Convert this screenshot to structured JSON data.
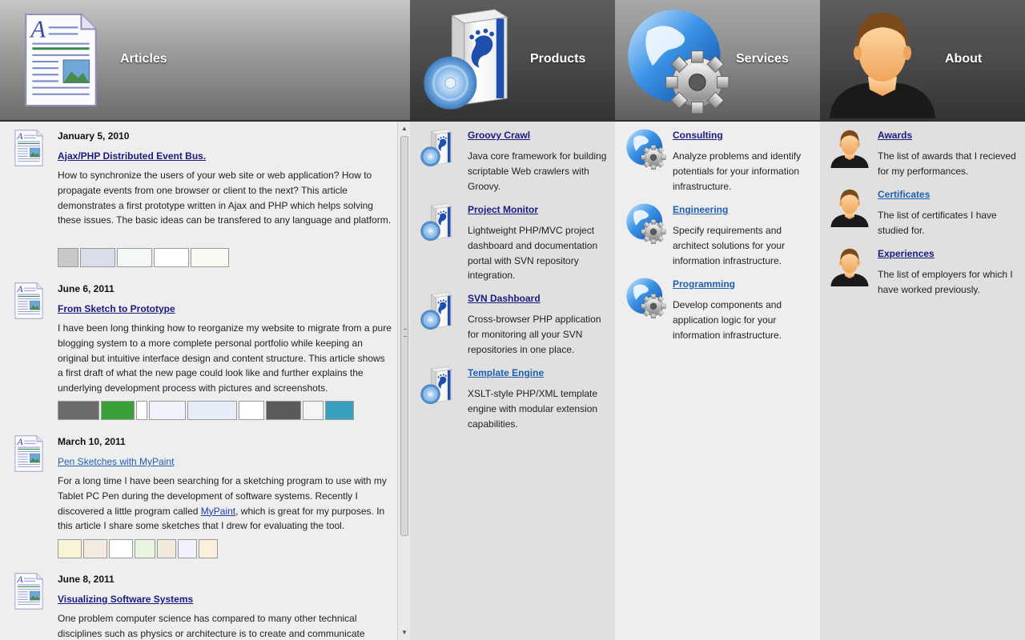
{
  "nav": {
    "articles": "Articles",
    "products": "Products",
    "services": "Services",
    "about": "About"
  },
  "articles": [
    {
      "date": "January 5, 2010",
      "title": "Ajax/PHP Distributed Event Bus.",
      "body": "How to synchronize the users of your web site or web application? How to propagate events from one browser or client to the next? This article demonstrates a first prototype written in Ajax and PHP which helps solving these issues. The basic ideas can be transfered to any language and platform."
    },
    {
      "date": "June 6, 2011",
      "title": "From Sketch to Prototype",
      "body": "I have been long thinking how to reorganize my website to migrate from a pure blogging system to a more complete personal portfolio while keeping an original but intuitive interface design and content structure. This article shows a first draft of what the new page could look like and further explains the underlying development process with pictures and screenshots."
    },
    {
      "date": "March 10, 2011",
      "title": "Pen Sketches with MyPaint",
      "body_before": "For a long time I have been searching for a sketching program to use with my Tablet PC Pen during the development of software systems. Recently I discovered a little program called ",
      "body_link": "MyPaint",
      "body_after": ", which is great for my purposes. In this article I share some sketches that I drew for evaluating the tool."
    },
    {
      "date": "June 8, 2011",
      "title": "Visualizing Software Systems",
      "body": "One problem computer science has compared to many other technical disciplines such as physics or architecture is to create and communicate"
    }
  ],
  "products": [
    {
      "title": "Groovy Crawl",
      "body": "Java core framework for building scriptable Web crawlers with Groovy."
    },
    {
      "title": "Project Monitor",
      "body": "Lightweight PHP/MVC project dashboard and documentation portal with SVN repository integration."
    },
    {
      "title": "SVN Dashboard",
      "body": "Cross-browser PHP application for monitoring all your SVN repositories in one place."
    },
    {
      "title": "Template Engine",
      "body": "XSLT-style PHP/XML template engine with modular extension capabilities."
    }
  ],
  "services": [
    {
      "title": "Consulting",
      "body": "Analyze problems and identify potentials for your information infrastructure."
    },
    {
      "title": "Engineering",
      "body": "Specify requirements and architect solutions for your information infrastructure."
    },
    {
      "title": "Programming",
      "body": "Develop components and application logic for your information infrastructure."
    }
  ],
  "about": [
    {
      "title": "Awards",
      "body": "The list of awards that I recieved for my performances."
    },
    {
      "title": "Certificates",
      "body": "The list of certificates I have studied for."
    },
    {
      "title": "Experiences",
      "body": "The list of employers for which I have worked previously."
    }
  ],
  "colors": {
    "link_visited": "#1a1a80",
    "link": "#1f5fb0",
    "header_dark": "#4b4b4b",
    "header_light": "#9a9a9a"
  }
}
